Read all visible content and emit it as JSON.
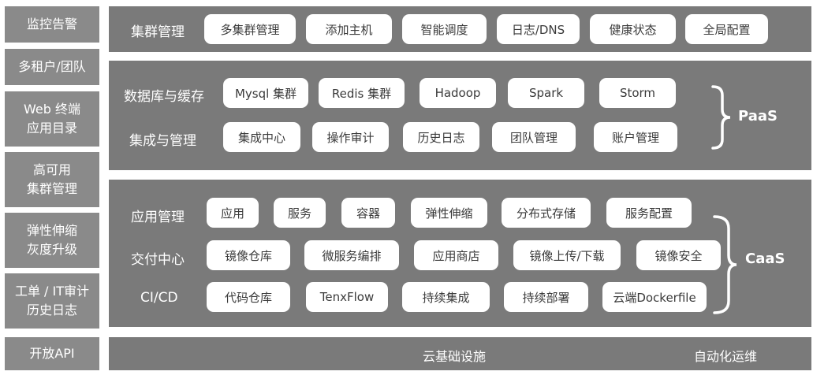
{
  "sidebar": [
    {
      "lines": [
        "监控告警"
      ]
    },
    {
      "lines": [
        "多租户/团队"
      ]
    },
    {
      "lines": [
        "Web 终端",
        "应用目录"
      ]
    },
    {
      "lines": [
        "高可用",
        "集群管理"
      ]
    },
    {
      "lines": [
        "弹性伸缩",
        "灰度升级"
      ]
    },
    {
      "lines": [
        "工单 / IT审计",
        "历史日志"
      ]
    },
    {
      "lines": [
        "开放API"
      ]
    }
  ],
  "cluster": {
    "label": "集群管理",
    "items": [
      "多集群管理",
      "添加主机",
      "智能调度",
      "日志/DNS",
      "健康状态",
      "全局配置"
    ]
  },
  "paas": {
    "tag": "PaaS",
    "rows": [
      {
        "label": "数据库与缓存",
        "items": [
          "Mysql 集群",
          "Redis 集群",
          "Hadoop",
          "Spark",
          "Storm"
        ]
      },
      {
        "label": "集成与管理",
        "items": [
          "集成中心",
          "操作审计",
          "历史日志",
          "团队管理",
          "账户管理"
        ]
      }
    ]
  },
  "caas": {
    "tag": "CaaS",
    "rows": [
      {
        "label": "应用管理",
        "items": [
          "应用",
          "服务",
          "容器",
          "弹性伸缩",
          "分布式存储",
          "服务配置"
        ]
      },
      {
        "label": "交付中心",
        "items": [
          "镜像仓库",
          "微服务编排",
          "应用商店",
          "镜像上传/下载",
          "镜像安全"
        ]
      },
      {
        "label": "CI/CD",
        "items": [
          "代码仓库",
          "TenxFlow",
          "持续集成",
          "持续部署",
          "云端Dockerfile"
        ]
      }
    ]
  },
  "infra": {
    "left": "云基础设施",
    "right": "自动化运维"
  },
  "colors": {
    "panel": "#7a7a7a",
    "sidebar": "#8a8a8a",
    "pill": "#ffffff",
    "text_on_pill": "#3a3a3a"
  }
}
